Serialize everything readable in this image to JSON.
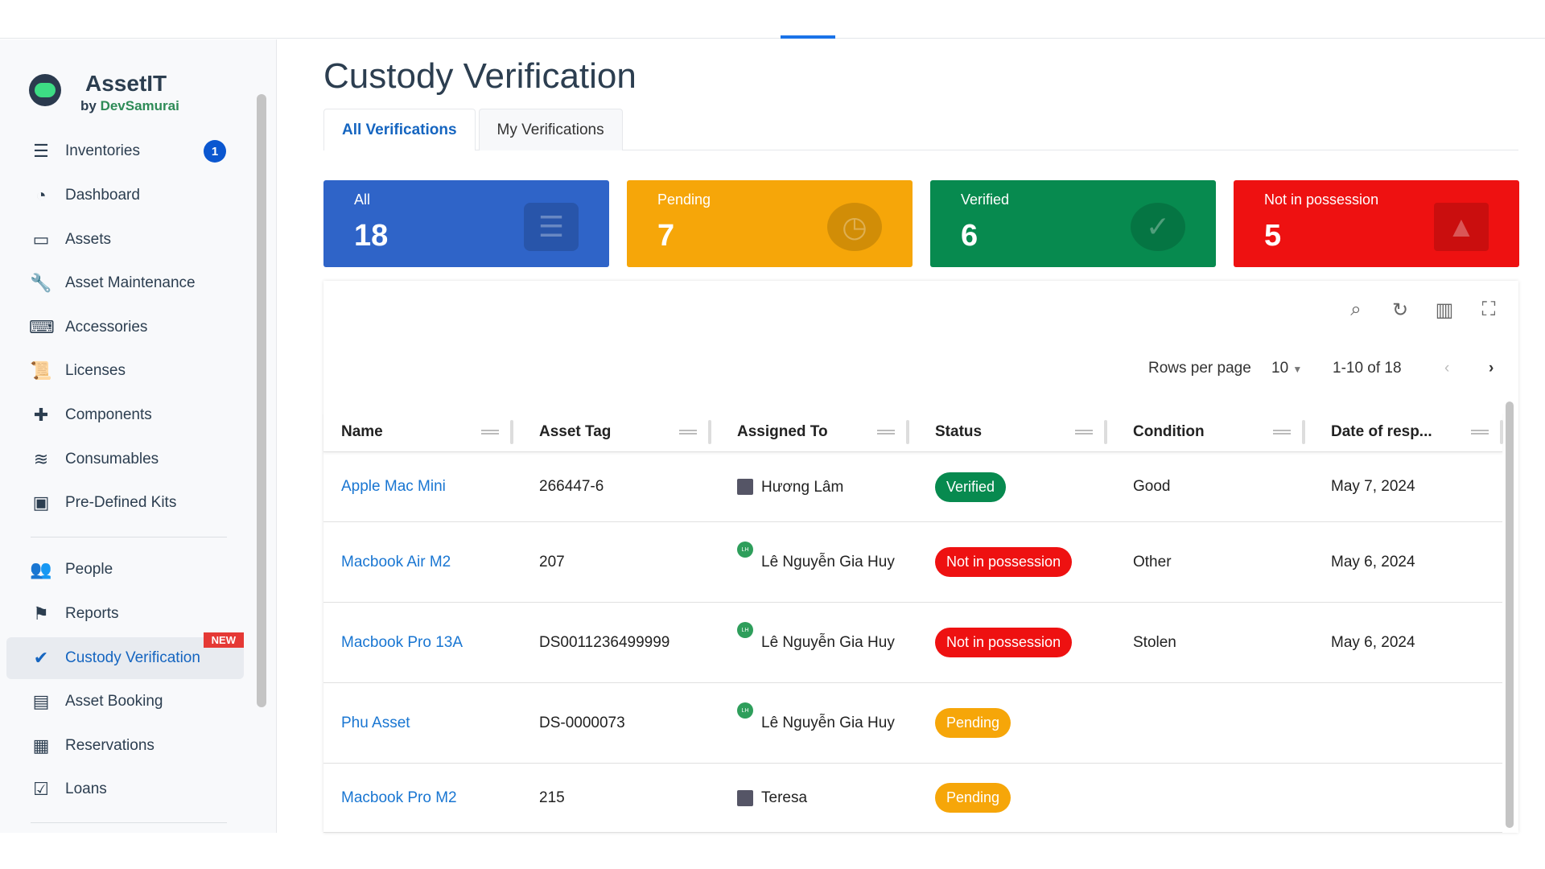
{
  "brand": {
    "name": "AssetIT",
    "by": "by",
    "company": "DevSamurai"
  },
  "sidebar": {
    "items": [
      {
        "label": "Inventories",
        "icon": "sliders-icon",
        "glyph": "☰",
        "badge": "1"
      },
      {
        "label": "Dashboard",
        "icon": "gauge-icon",
        "glyph": "◔"
      },
      {
        "label": "Assets",
        "icon": "laptop-icon",
        "glyph": "▭"
      },
      {
        "label": "Asset Maintenance",
        "icon": "wrench-icon",
        "glyph": "🔧"
      },
      {
        "label": "Accessories",
        "icon": "keyboard-icon",
        "glyph": "⌨"
      },
      {
        "label": "Licenses",
        "icon": "scroll-icon",
        "glyph": "📜"
      },
      {
        "label": "Components",
        "icon": "puzzle-icon",
        "glyph": "✚"
      },
      {
        "label": "Consumables",
        "icon": "layers-icon",
        "glyph": "≋"
      },
      {
        "label": "Pre-Defined Kits",
        "icon": "toolbox-icon",
        "glyph": "▣"
      },
      {
        "label": "People",
        "icon": "users-icon",
        "glyph": "👥"
      },
      {
        "label": "Reports",
        "icon": "flag-icon",
        "glyph": "⚑"
      },
      {
        "label": "Custody Verification",
        "icon": "verified-badge-icon",
        "glyph": "✔",
        "new": "NEW",
        "active": true
      },
      {
        "label": "Asset Booking",
        "icon": "booking-icon",
        "glyph": "▤"
      },
      {
        "label": "Reservations",
        "icon": "calendar-icon",
        "glyph": "▦"
      },
      {
        "label": "Loans",
        "icon": "calendar-check-icon",
        "glyph": "☑"
      }
    ]
  },
  "page": {
    "title": "Custody Verification",
    "tabs": [
      {
        "label": "All Verifications",
        "active": true
      },
      {
        "label": "My Verifications"
      }
    ]
  },
  "cards": [
    {
      "label": "All",
      "value": "18",
      "color": "#2f64c8",
      "icon": "list-icon"
    },
    {
      "label": "Pending",
      "value": "7",
      "color": "#f6a609",
      "icon": "clock-icon"
    },
    {
      "label": "Verified",
      "value": "6",
      "color": "#078a4f",
      "icon": "check-circle-icon"
    },
    {
      "label": "Not in possession",
      "value": "5",
      "color": "#ee1111",
      "icon": "warning-icon"
    }
  ],
  "toolbar": {
    "icons": [
      "search-icon",
      "refresh-icon",
      "columns-icon",
      "fullscreen-icon"
    ]
  },
  "pagination": {
    "rows_label": "Rows per page",
    "rows_value": "10",
    "range": "1-10 of 18"
  },
  "table": {
    "columns": [
      "Name",
      "Asset Tag",
      "Assigned To",
      "Status",
      "Condition",
      "Date of resp..."
    ],
    "rows": [
      {
        "name": "Apple Mac Mini",
        "tag": "266447-6",
        "assigned": "Hương Lâm",
        "avatar": "photo",
        "status": "Verified",
        "condition": "Good",
        "date": "May 7, 2024"
      },
      {
        "name": "Macbook Air M2",
        "tag": "207",
        "assigned": "Lê Nguyễn Gia Huy",
        "avatar": "LH",
        "status": "Not in possession",
        "condition": "Other",
        "date": "May 6, 2024"
      },
      {
        "name": "Macbook Pro 13A",
        "tag": "DS0011236499999",
        "assigned": "Lê Nguyễn Gia Huy",
        "avatar": "LH",
        "status": "Not in possession",
        "condition": "Stolen",
        "date": "May 6, 2024"
      },
      {
        "name": "Phu Asset",
        "tag": "DS-0000073",
        "assigned": "Lê Nguyễn Gia Huy",
        "avatar": "LH",
        "status": "Pending",
        "condition": "",
        "date": ""
      },
      {
        "name": "Macbook Pro M2",
        "tag": "215",
        "assigned": "Teresa",
        "avatar": "photo",
        "status": "Pending",
        "condition": "",
        "date": ""
      }
    ]
  },
  "status_colors": {
    "Verified": "#078a4f",
    "Not in possession": "#ee1111",
    "Pending": "#f6a609"
  }
}
